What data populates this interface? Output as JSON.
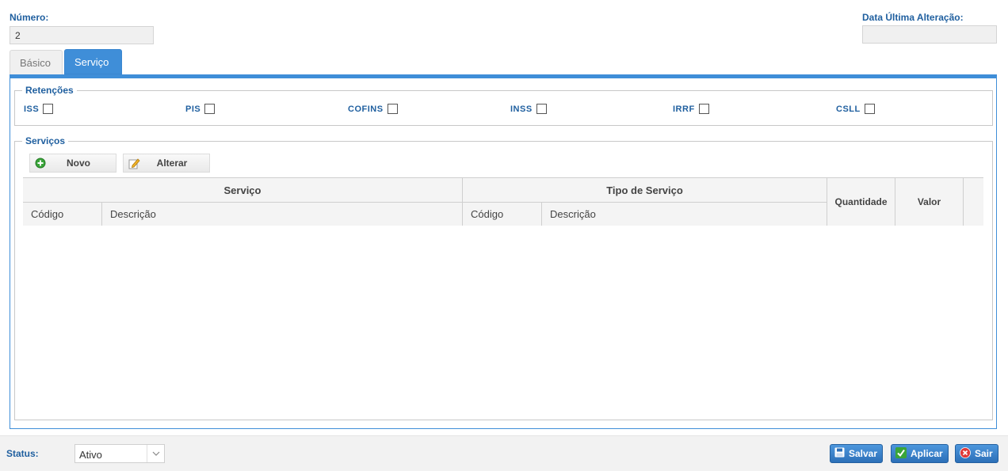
{
  "header": {
    "numero_label": "Número:",
    "numero_value": "2",
    "data_label": "Data Última Alteração:",
    "data_value": ""
  },
  "tabs": [
    {
      "label": "Básico",
      "active": false
    },
    {
      "label": "Serviço",
      "active": true
    }
  ],
  "retencoes": {
    "legend": "Retenções",
    "items": [
      {
        "label": "ISS",
        "checked": false
      },
      {
        "label": "PIS",
        "checked": false
      },
      {
        "label": "COFINS",
        "checked": false
      },
      {
        "label": "INSS",
        "checked": false
      },
      {
        "label": "IRRF",
        "checked": false
      },
      {
        "label": "CSLL",
        "checked": false
      }
    ]
  },
  "servicos": {
    "legend": "Serviços",
    "buttons": {
      "novo": "Novo",
      "alterar": "Alterar"
    },
    "table": {
      "group_servico": "Serviço",
      "group_tipo": "Tipo de Serviço",
      "col_codigo_1": "Código",
      "col_descricao_1": "Descrição",
      "col_codigo_2": "Código",
      "col_descricao_2": "Descrição",
      "col_quantidade": "Quantidade",
      "col_valor": "Valor",
      "rows": []
    }
  },
  "footer": {
    "status_label": "Status:",
    "status_value": "Ativo",
    "salvar": "Salvar",
    "aplicar": "Aplicar",
    "sair": "Sair"
  },
  "colors": {
    "accent": "#3f8ed8",
    "label": "#1f5f9f"
  },
  "icons": [
    "add-icon",
    "edit-icon",
    "save-icon",
    "check-icon",
    "close-icon",
    "chevron-down-icon"
  ]
}
